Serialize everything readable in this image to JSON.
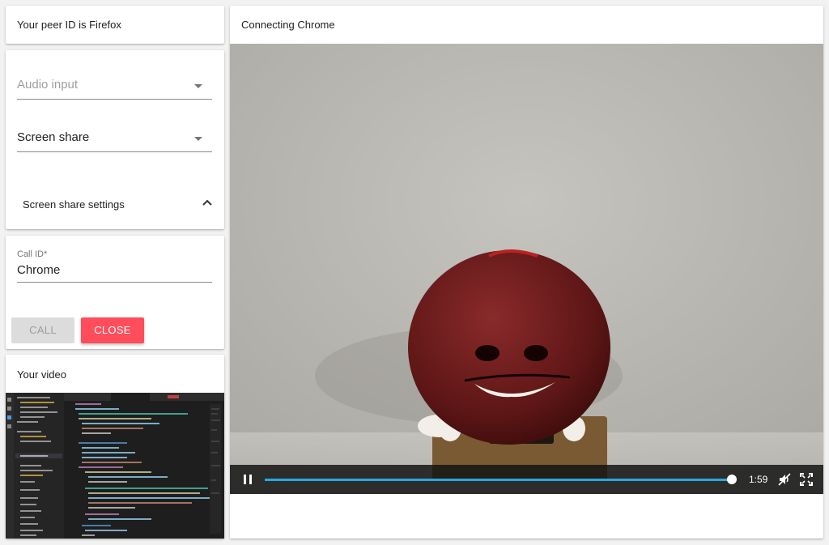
{
  "peer": {
    "title": "Your peer ID is Firefox"
  },
  "settings": {
    "audio_input": {
      "placeholder": "Audio input"
    },
    "screen_share": {
      "value": "Screen share"
    },
    "screen_share_settings": {
      "label": "Screen share settings",
      "expanded": false
    }
  },
  "call": {
    "label": "Call ID*",
    "value": "Chrome",
    "call_button": "CALL",
    "close_button": "CLOSE",
    "close_color": "#ff4d5b"
  },
  "local_video": {
    "title": "Your video"
  },
  "remote": {
    "title": "Connecting Chrome",
    "player": {
      "progress": 0.99,
      "time": "1:59",
      "icons": [
        "pause-icon",
        "volume-muted-icon",
        "fullscreen-icon"
      ],
      "accent": "#29a8e0"
    }
  }
}
